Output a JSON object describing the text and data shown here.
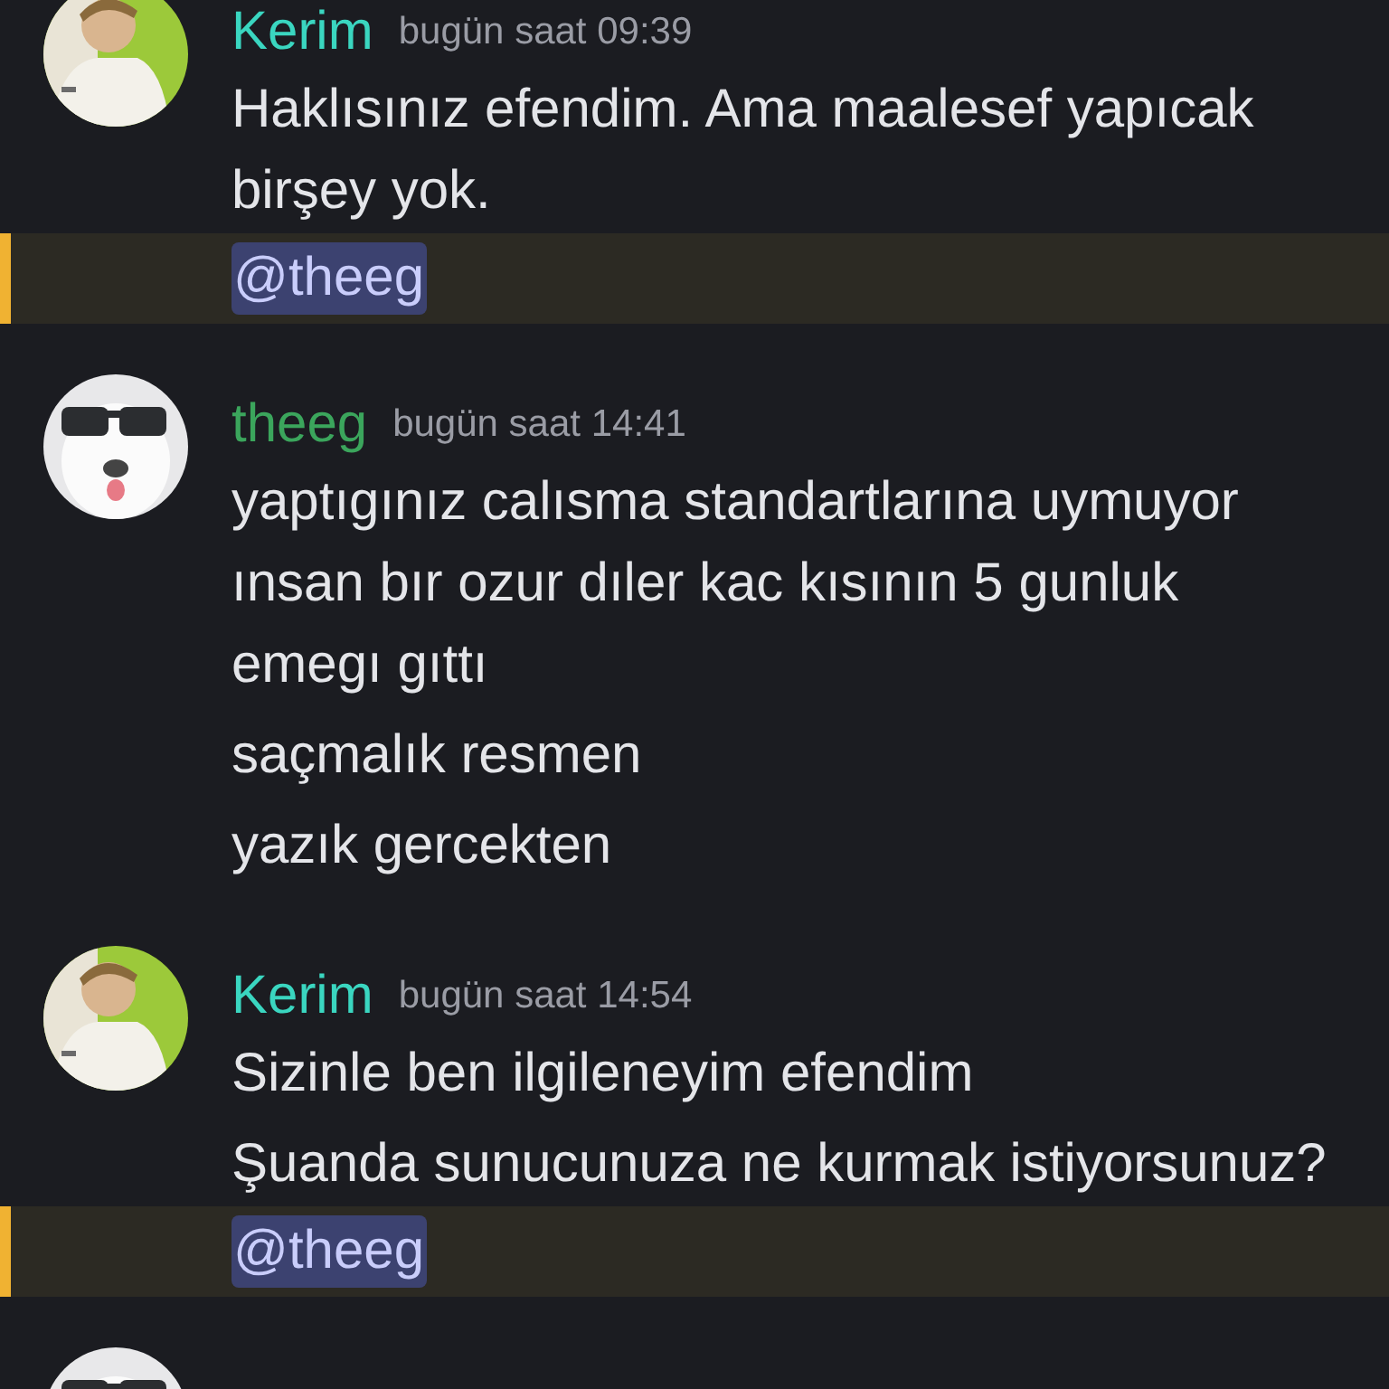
{
  "messages": [
    {
      "author": "Kerim",
      "color": "#3ad6c0",
      "time": "bugün saat 09:39",
      "avatar": {
        "kind": "picture"
      },
      "lines": [
        {
          "kind": "text",
          "text": "Haklısınız efendim. Ama maalesef yapıcak birşey yok."
        },
        {
          "kind": "mention",
          "text": "@theeg"
        }
      ]
    },
    {
      "author": "theeg",
      "color": "#3ba55c",
      "time": "bugün saat 14:41",
      "avatar": {
        "kind": "picture"
      },
      "lines": [
        {
          "kind": "text",
          "text": "yaptıgınız calısma standartlarına uymuyor ınsan bır ozur dıler kac kısının 5 gunluk emegı gıttı"
        },
        {
          "kind": "text",
          "text": "saçmalık resmen"
        },
        {
          "kind": "text",
          "text": "yazık gercekten"
        }
      ]
    },
    {
      "author": "Kerim",
      "color": "#3ad6c0",
      "time": "bugün saat 14:54",
      "avatar": {
        "kind": "picture"
      },
      "lines": [
        {
          "kind": "text",
          "text": "Sizinle ben ilgileneyim efendim"
        },
        {
          "kind": "text",
          "text": "Şuanda sunucunuza ne kurmak istiyorsunuz?"
        },
        {
          "kind": "mention",
          "text": "@theeg"
        }
      ]
    },
    {
      "avatar": {
        "kind": "picture"
      }
    }
  ]
}
